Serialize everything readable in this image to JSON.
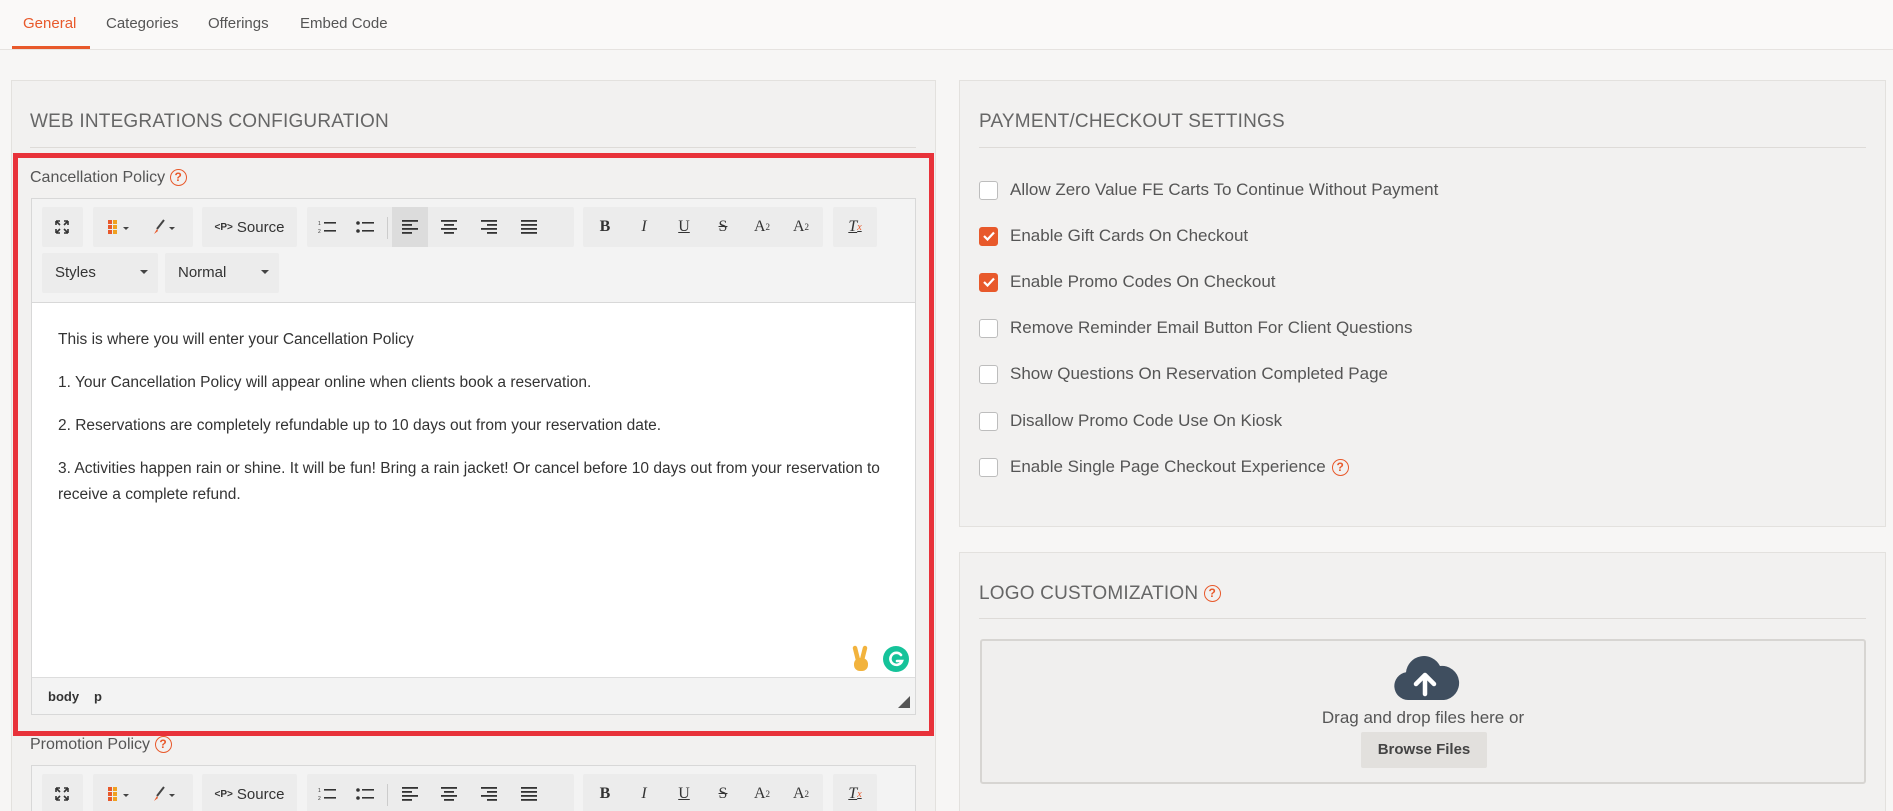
{
  "tabs": [
    {
      "label": "General",
      "active": true
    },
    {
      "label": "Categories",
      "active": false
    },
    {
      "label": "Offerings",
      "active": false
    },
    {
      "label": "Embed Code",
      "active": false
    }
  ],
  "web_integrations": {
    "title": "WEB INTEGRATIONS CONFIGURATION",
    "cancellation_policy": {
      "label": "Cancellation Policy",
      "toolbar": {
        "source_label": "Source",
        "styles_label": "Styles",
        "format_label": "Normal"
      },
      "content": [
        "This is where you will enter your Cancellation Policy",
        "1. Your Cancellation Policy will appear online when clients book a reservation.",
        "2. Reservations are completely refundable up to 10 days out from your reservation date.",
        "3. Activities happen rain or shine. It will be fun! Bring a rain jacket! Or cancel before 10 days out from your reservation to receive a complete refund."
      ],
      "path": [
        "body",
        "p"
      ]
    },
    "promotion_policy": {
      "label": "Promotion Policy",
      "toolbar": {
        "source_label": "Source"
      }
    }
  },
  "payment": {
    "title": "PAYMENT/CHECKOUT SETTINGS",
    "options": [
      {
        "label": "Allow Zero Value FE Carts To Continue Without Payment",
        "checked": false
      },
      {
        "label": "Enable Gift Cards On Checkout",
        "checked": true
      },
      {
        "label": "Enable Promo Codes On Checkout",
        "checked": true
      },
      {
        "label": "Remove Reminder Email Button For Client Questions",
        "checked": false
      },
      {
        "label": "Show Questions On Reservation Completed Page",
        "checked": false
      },
      {
        "label": "Disallow Promo Code Use On Kiosk",
        "checked": false
      },
      {
        "label": "Enable Single Page Checkout Experience",
        "checked": false,
        "help": true
      }
    ]
  },
  "logo": {
    "title": "LOGO CUSTOMIZATION",
    "drop_text": "Drag and drop files here or",
    "browse_label": "Browse Files"
  },
  "help_glyph": "?",
  "colors": {
    "accent": "#e8592b",
    "highlight": "#e8323a",
    "grammarly": "#15c39a"
  }
}
